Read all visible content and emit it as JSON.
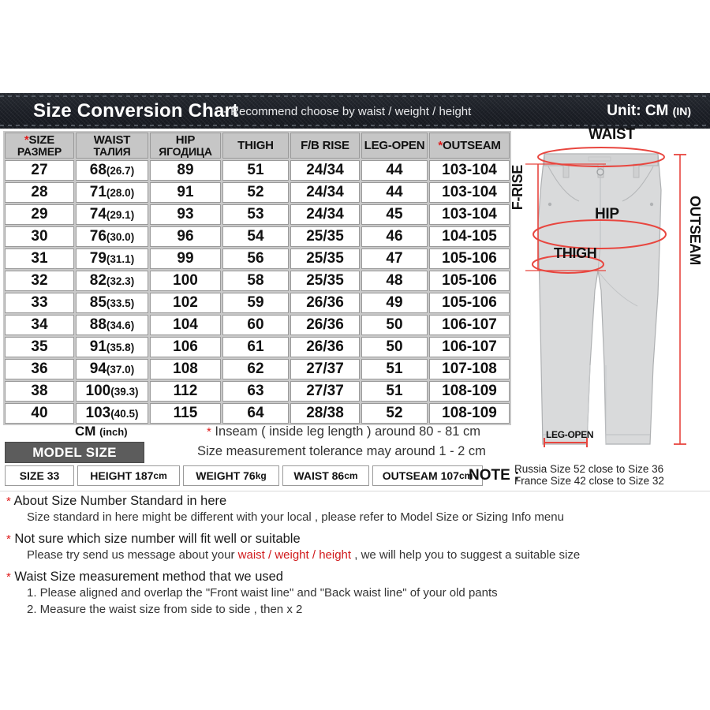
{
  "header": {
    "title": "Size Conversion Chart",
    "subtitle": "-  Recommend choose by waist / weight / height",
    "unit_main": "Unit: CM ",
    "unit_small": "(IN)"
  },
  "table": {
    "columns": [
      {
        "star": true,
        "line1": "SIZE",
        "line2": "РАЗМЕР"
      },
      {
        "star": false,
        "line1": "WAIST",
        "line2": "ТАЛИЯ"
      },
      {
        "star": false,
        "line1": "HIP",
        "line2": "ЯГОДИЦА"
      },
      {
        "star": false,
        "line1": "THIGH",
        "line2": ""
      },
      {
        "star": false,
        "line1": "F/B RISE",
        "line2": ""
      },
      {
        "star": false,
        "line1": "LEG-OPEN",
        "line2": ""
      },
      {
        "star": true,
        "line1": "OUTSEAM",
        "line2": ""
      }
    ],
    "rows": [
      {
        "size": "27",
        "waist_cm": "68",
        "waist_in": "(26.7)",
        "hip": "89",
        "thigh": "51",
        "rise": "24/34",
        "leg_open": "44",
        "outseam": "103-104"
      },
      {
        "size": "28",
        "waist_cm": "71",
        "waist_in": "(28.0)",
        "hip": "91",
        "thigh": "52",
        "rise": "24/34",
        "leg_open": "44",
        "outseam": "103-104"
      },
      {
        "size": "29",
        "waist_cm": "74",
        "waist_in": "(29.1)",
        "hip": "93",
        "thigh": "53",
        "rise": "24/34",
        "leg_open": "45",
        "outseam": "103-104"
      },
      {
        "size": "30",
        "waist_cm": "76",
        "waist_in": "(30.0)",
        "hip": "96",
        "thigh": "54",
        "rise": "25/35",
        "leg_open": "46",
        "outseam": "104-105"
      },
      {
        "size": "31",
        "waist_cm": "79",
        "waist_in": "(31.1)",
        "hip": "99",
        "thigh": "56",
        "rise": "25/35",
        "leg_open": "47",
        "outseam": "105-106"
      },
      {
        "size": "32",
        "waist_cm": "82",
        "waist_in": "(32.3)",
        "hip": "100",
        "thigh": "58",
        "rise": "25/35",
        "leg_open": "48",
        "outseam": "105-106"
      },
      {
        "size": "33",
        "waist_cm": "85",
        "waist_in": "(33.5)",
        "hip": "102",
        "thigh": "59",
        "rise": "26/36",
        "leg_open": "49",
        "outseam": "105-106"
      },
      {
        "size": "34",
        "waist_cm": "88",
        "waist_in": "(34.6)",
        "hip": "104",
        "thigh": "60",
        "rise": "26/36",
        "leg_open": "50",
        "outseam": "106-107"
      },
      {
        "size": "35",
        "waist_cm": "91",
        "waist_in": "(35.8)",
        "hip": "106",
        "thigh": "61",
        "rise": "26/36",
        "leg_open": "50",
        "outseam": "106-107"
      },
      {
        "size": "36",
        "waist_cm": "94",
        "waist_in": "(37.0)",
        "hip": "108",
        "thigh": "62",
        "rise": "27/37",
        "leg_open": "51",
        "outseam": "107-108"
      },
      {
        "size": "38",
        "waist_cm": "100",
        "waist_in": "(39.3)",
        "hip": "112",
        "thigh": "63",
        "rise": "27/37",
        "leg_open": "51",
        "outseam": "108-109"
      },
      {
        "size": "40",
        "waist_cm": "103",
        "waist_in": "(40.5)",
        "hip": "115",
        "thigh": "64",
        "rise": "28/38",
        "leg_open": "52",
        "outseam": "108-109"
      }
    ]
  },
  "units_label": {
    "cm": "CM ",
    "inch": "(inch)"
  },
  "inseam": {
    "line1_star": "*",
    "line1": " Inseam ( inside leg length ) around  80 - 81 cm",
    "line2": "Size measurement tolerance may around 1 - 2 cm"
  },
  "model_size": {
    "heading": "MODEL SIZE",
    "cells": [
      {
        "label": "SIZE 33",
        "unit": ""
      },
      {
        "label": "HEIGHT 187 ",
        "unit": "cm"
      },
      {
        "label": "WEIGHT 76 ",
        "unit": "kg"
      },
      {
        "label": "WAIST 86 ",
        "unit": "cm"
      },
      {
        "label": "OUTSEAM 107 ",
        "unit": "cm"
      }
    ]
  },
  "note": {
    "label": "NOTE :",
    "line1": "Russia  Size 52 close to Size 36",
    "line2": "France Size 42 close to Size 32"
  },
  "instructions": [
    {
      "star": "*",
      "heading": " About Size Number Standard in here",
      "body_pre": "Size standard in here might be different with your local , please refer to Model Size or Sizing Info menu",
      "body_red": "",
      "body_post": ""
    },
    {
      "star": "*",
      "heading": " Not sure which size number will fit well or suitable",
      "body_pre": "Please try send us message about your ",
      "body_red": "waist / weight / height",
      "body_post": " , we will help you to suggest a suitable size"
    }
  ],
  "waist_method": {
    "star": "*",
    "heading": " Waist Size measurement method that we used",
    "step1": "1. Please aligned and overlap the \"Front waist line\" and \"Back waist line\" of your old pants",
    "step2": "2. Measure the waist size from side to side , then x 2"
  },
  "diagram": {
    "waist": "WAIST",
    "hip": "HIP",
    "thigh": "THIGH",
    "f_rise": "F-RISE",
    "outseam": "OUTSEAM",
    "leg_open": "LEG-OPEN"
  },
  "colors": {
    "denim": "#1a1d24",
    "star_red": "#e01b1b",
    "accent_red": "#d0191b",
    "header_gray": "#c6c6c6",
    "model_bar": "#5c5c5c",
    "pants_fill": "#d9dadb",
    "measure_red": "#e8463f"
  }
}
